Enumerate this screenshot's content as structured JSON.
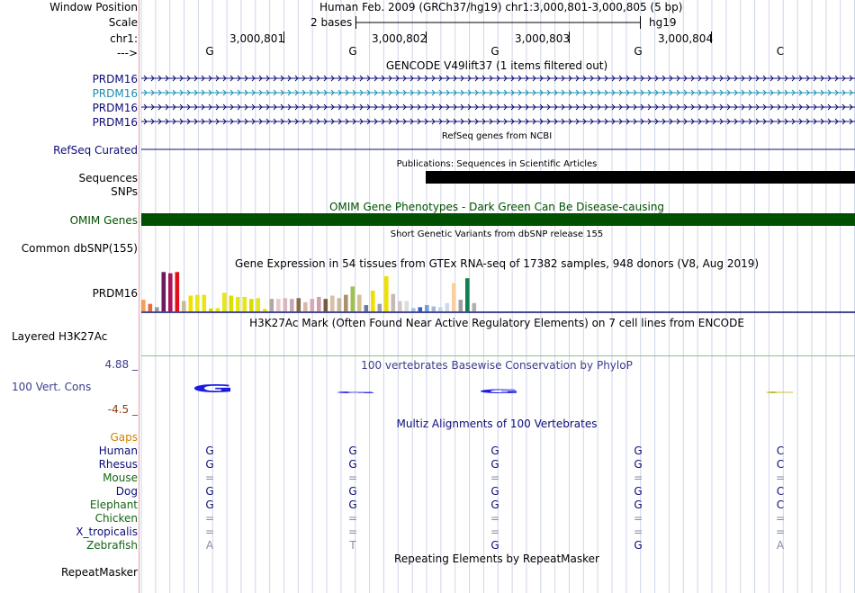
{
  "header": {
    "window_position_label": "Window Position",
    "scale_label": "Scale",
    "chrom_label": "chr1:",
    "strand_label": "--->",
    "assembly_title": "Human Feb. 2009 (GRCh37/hg19)   chr1:3,000,801-3,000,805 (5 bp)",
    "scale_text": "2 bases",
    "scale_db": "hg19",
    "positions": [
      "3,000,801",
      "3,000,802",
      "3,000,803",
      "3,000,804"
    ],
    "bases": [
      "G",
      "G",
      "G",
      "G",
      "C"
    ]
  },
  "tracks": {
    "gencode": {
      "title": "GENCODE V49lift37 (1 items filtered out)",
      "items": [
        "PRDM16",
        "PRDM16",
        "PRDM16",
        "PRDM16"
      ],
      "colors": [
        "#0c0c78",
        "#1a8cb0",
        "#0c0c78",
        "#0c0c78"
      ]
    },
    "refseq": {
      "title": "RefSeq genes from NCBI",
      "label": "RefSeq Curated",
      "color": "#0c0c78"
    },
    "publications": {
      "title": "Publications: Sequences in Scientific Articles",
      "label1": "Sequences",
      "label2": "SNPs"
    },
    "omim": {
      "title": "OMIM Gene Phenotypes - Dark Green Can Be Disease-causing",
      "label": "OMIM Genes",
      "color": "#005000"
    },
    "dbsnp": {
      "title": "Short Genetic Variants from dbSNP release 155",
      "label": "Common dbSNP(155)"
    },
    "gtex": {
      "title": "Gene Expression in 54 tissues from GTEx RNA-seq of 17382 samples, 948 donors (V8, Aug 2019)",
      "label": "PRDM16",
      "bar_levels": [
        0.28,
        0.18,
        0.1,
        0.95,
        0.92,
        0.95,
        0.25,
        0.38,
        0.4,
        0.4,
        0.07,
        0.08,
        0.45,
        0.38,
        0.35,
        0.35,
        0.3,
        0.32,
        0.06,
        0.3,
        0.3,
        0.32,
        0.3,
        0.32,
        0.22,
        0.3,
        0.35,
        0.3,
        0.38,
        0.32,
        0.4,
        0.6,
        0.4,
        0.15,
        0.5,
        0.18,
        0.85,
        0.42,
        0.25,
        0.25,
        0.08,
        0.1,
        0.15,
        0.12,
        0.1,
        0.2,
        0.68,
        0.28,
        0.8,
        0.2
      ],
      "bar_colors": [
        "#f5a05a",
        "#e86b3a",
        "#9a9a9a",
        "#6b1c5e",
        "#a8155a",
        "#e0101a",
        "#c9b89e",
        "#f0e000",
        "#e6e61a",
        "#e6e61a",
        "#d9d900",
        "#e6e61a",
        "#e6e61a",
        "#dede00",
        "#e6e61a",
        "#e6e61a",
        "#dada00",
        "#e6e61a",
        "#f0e000",
        "#aaaaaa",
        "#e8c8c8",
        "#d6b8c0",
        "#c8a8b0",
        "#8a6a4a",
        "#d8b8a8",
        "#d6a8b8",
        "#cfa0b0",
        "#7a5a3a",
        "#d8c0a8",
        "#c8b8a0",
        "#a89070",
        "#a0c050",
        "#d8c090",
        "#6878a8",
        "#f0e000",
        "#a0a0a0",
        "#f0e000",
        "#c8b8b8",
        "#d0c8c8",
        "#dcdcdc",
        "#a8c0e8",
        "#3060c0",
        "#70a0e0",
        "#a8b8d8",
        "#c8d0e8",
        "#d0d8e8",
        "#f8d0a0",
        "#a0a0a0",
        "#108050",
        "#b0b0b0"
      ]
    },
    "h3k27ac": {
      "title": "H3K27Ac Mark (Often Found Near Active Regulatory Elements) on 7 cell lines from ENCODE",
      "label": "Layered H3K27Ac"
    },
    "phylop": {
      "title": "100 vertebrates Basewise Conservation by PhyloP",
      "label": "100 Vert. Cons",
      "max": "4.88 _",
      "min": "-4.5 _",
      "max_color": "#3c3c8c",
      "min_color": "#8c3c14"
    },
    "multiz": {
      "title": "Multiz Alignments of 100 Vertebrates",
      "gaps_label": "Gaps",
      "species": [
        {
          "name": "Human",
          "color": "#0c0c78",
          "bases": [
            "G",
            "G",
            "G",
            "G",
            "C"
          ]
        },
        {
          "name": "Rhesus",
          "color": "#0c0c78",
          "bases": [
            "G",
            "G",
            "G",
            "G",
            "C"
          ]
        },
        {
          "name": "Mouse",
          "color": "#146414",
          "bases": [
            "=",
            "=",
            "=",
            "=",
            "="
          ]
        },
        {
          "name": "Dog",
          "color": "#0c0c78",
          "bases": [
            "G",
            "G",
            "G",
            "G",
            "C"
          ]
        },
        {
          "name": "Elephant",
          "color": "#146414",
          "bases": [
            "G",
            "G",
            "G",
            "G",
            "C"
          ]
        },
        {
          "name": "Chicken",
          "color": "#146414",
          "bases": [
            "=",
            "=",
            "=",
            "=",
            "="
          ]
        },
        {
          "name": "X_tropicalis",
          "color": "#0c0c78",
          "bases": [
            "=",
            "=",
            "=",
            "=",
            "="
          ]
        },
        {
          "name": "Zebrafish",
          "color": "#146414",
          "bases": [
            "A",
            "T",
            "G",
            "G",
            "A"
          ]
        }
      ]
    },
    "repeatmasker": {
      "title": "Repeating Elements by RepeatMasker",
      "label": "RepeatMasker"
    }
  }
}
